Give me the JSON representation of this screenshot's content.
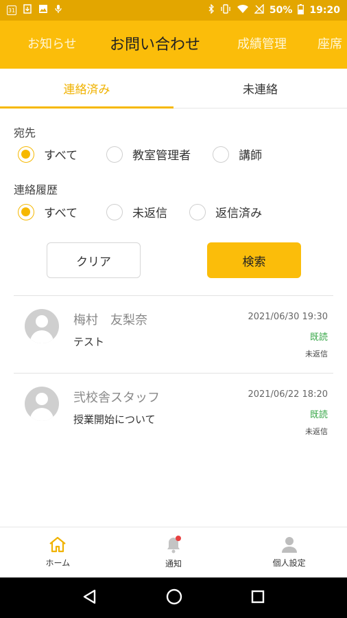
{
  "status_bar": {
    "calendar_day": "31",
    "battery": "50%",
    "time": "19:20"
  },
  "top_nav": {
    "tabs": [
      {
        "label": "お知らせ"
      },
      {
        "label": "お問い合わせ"
      },
      {
        "label": "成績管理"
      },
      {
        "label": "座席"
      }
    ],
    "active": "お問い合わせ"
  },
  "sub_tabs": [
    {
      "label": "連絡済み",
      "active": true
    },
    {
      "label": "未連絡",
      "active": false
    }
  ],
  "filters": {
    "destination": {
      "label": "宛先",
      "options": [
        "すべて",
        "教室管理者",
        "講師"
      ],
      "selected": "すべて"
    },
    "history": {
      "label": "連絡履歴",
      "options": [
        "すべて",
        "未返信",
        "返信済み"
      ],
      "selected": "すべて"
    },
    "clear_label": "クリア",
    "search_label": "検索"
  },
  "messages": [
    {
      "name": "梅村　友梨奈",
      "subject": "テスト",
      "date": "2021/06/30 19:30",
      "read_status": "既読",
      "reply_status": "未返信"
    },
    {
      "name": "弐校舎スタッフ",
      "subject": "授業開始について",
      "date": "2021/06/22 18:20",
      "read_status": "既読",
      "reply_status": "未返信"
    }
  ],
  "bottom_nav": [
    {
      "label": "ホーム",
      "icon": "home-icon"
    },
    {
      "label": "通知",
      "icon": "bell-icon"
    },
    {
      "label": "個人設定",
      "icon": "person-icon"
    }
  ],
  "colors": {
    "accent": "#fbbd0a",
    "read": "#3aa84a"
  }
}
